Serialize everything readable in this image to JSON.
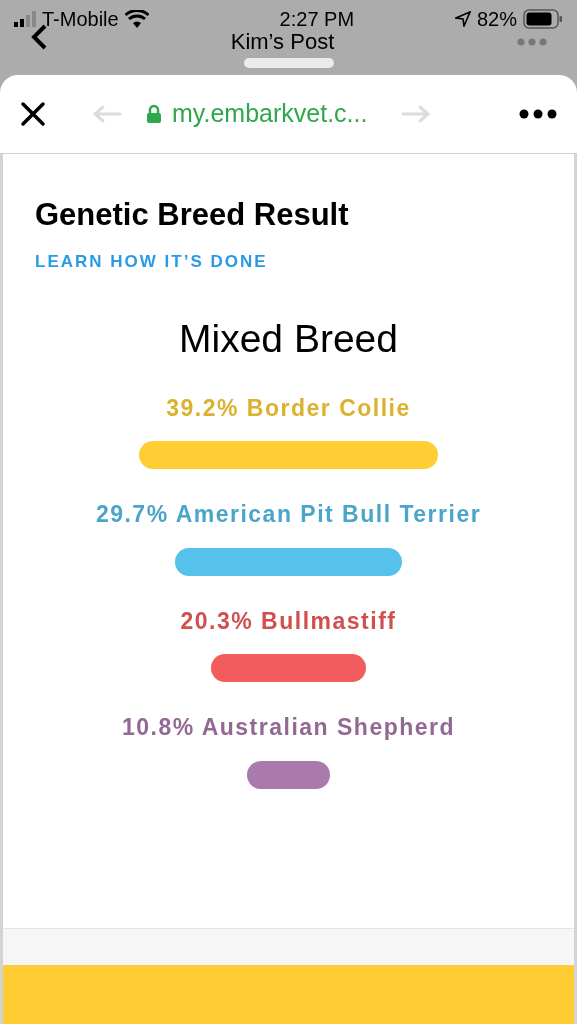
{
  "status_bar": {
    "carrier": "T-Mobile",
    "time": "2:27 PM",
    "battery": "82%"
  },
  "app_header": {
    "title": "Kim’s Post"
  },
  "browser_bar": {
    "url": "my.embarkvet.c..."
  },
  "page": {
    "title": "Genetic Breed Result",
    "link": "LEARN HOW IT’S DONE",
    "result": "Mixed Breed",
    "breeds": [
      {
        "label": "39.2% Border Collie",
        "color": "#ffce34"
      },
      {
        "label": "29.7% American Pit Bull Terrier",
        "color": "#56c1ea"
      },
      {
        "label": "20.3% Bullmastiff",
        "color": "#f25c5c"
      },
      {
        "label": "10.8% Australian Shepherd",
        "color": "#a97aab"
      }
    ]
  }
}
